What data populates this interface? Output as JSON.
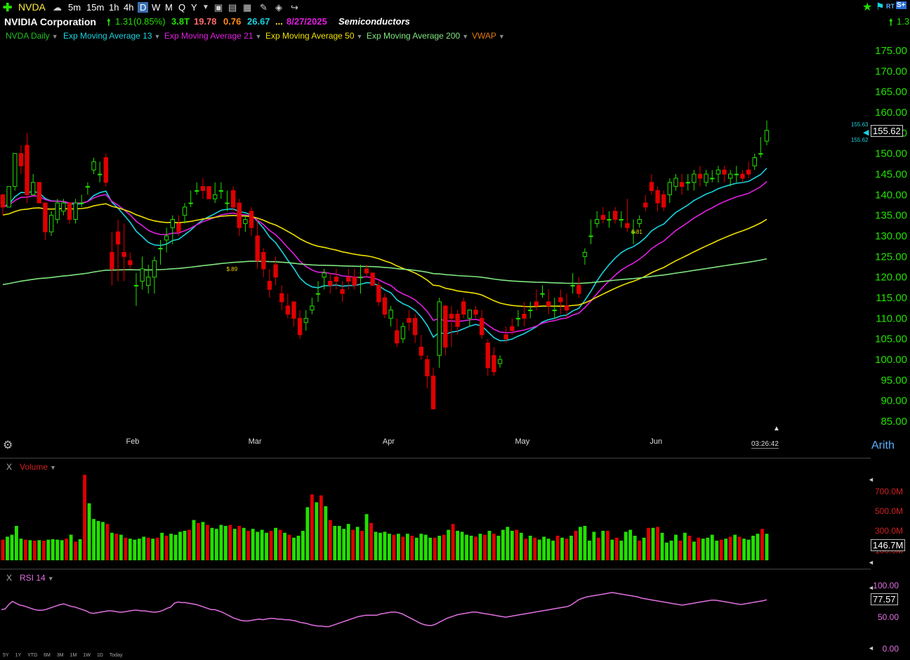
{
  "toolbar": {
    "symbol": "NVDA",
    "timeframes": [
      "5m",
      "15m",
      "1h",
      "4h",
      "D",
      "W",
      "M",
      "Q",
      "Y"
    ],
    "active_timeframe": "D",
    "rt_label": "RT",
    "right_change": "1.3"
  },
  "info": {
    "company": "NVIDIA Corporation",
    "change": "1.31",
    "change_pct": "(0.85%)",
    "market_cap": "3.8T",
    "v1": "19.78",
    "v2": "0.76",
    "v3": "26.67",
    "ellipsis": "...",
    "date": "8/27/2025",
    "sector": "Semiconductors"
  },
  "studies": [
    {
      "label": "NVDA Daily",
      "color": "#20c020"
    },
    {
      "label": "Exp Moving Average 13",
      "color": "#19d3e0"
    },
    {
      "label": "Exp Moving Average 21",
      "color": "#e020e0"
    },
    {
      "label": "Exp Moving Average 50",
      "color": "#f0e000"
    },
    {
      "label": "Exp Moving Average 200",
      "color": "#7fe57f"
    },
    {
      "label": "VWAP",
      "color": "#e07a10"
    }
  ],
  "colors": {
    "up": "#22e000",
    "down": "#e00000",
    "price_axis": "#22e000",
    "volume_label": "#d02020",
    "rsi": "#e070e0"
  },
  "chart_data": {
    "type": "candlestick",
    "y_axis_ticks": [
      "175.00",
      "170.00",
      "165.00",
      "160.00",
      "155.00",
      "150.00",
      "145.00",
      "140.00",
      "135.00",
      "130.00",
      "125.00",
      "120.00",
      "115.00",
      "110.00",
      "105.00",
      "100.00",
      "95.00",
      "90.00",
      "85.00"
    ],
    "ylim": [
      85,
      175
    ],
    "x_axis_labels": [
      "Feb",
      "Mar",
      "Apr",
      "May",
      "Jun"
    ],
    "last_price": "155.62",
    "bid_label": "155.63",
    "ask_label": "155.62",
    "time_readout": "03:26:42",
    "scale_mode": "Arith",
    "candles": [
      [
        140,
        140,
        135,
        137
      ],
      [
        137,
        142,
        137,
        142
      ],
      [
        142,
        150,
        141,
        150
      ],
      [
        150,
        152,
        145,
        147
      ],
      [
        152,
        155,
        138,
        140
      ],
      [
        140,
        145,
        140,
        143
      ],
      [
        143,
        143,
        138,
        138
      ],
      [
        138,
        138,
        129,
        131
      ],
      [
        131,
        136,
        130,
        135
      ],
      [
        134,
        139,
        133,
        138
      ],
      [
        136,
        139,
        135,
        138
      ],
      [
        138,
        138,
        133,
        134
      ],
      [
        134,
        139,
        133,
        138
      ],
      [
        138,
        140,
        137,
        138
      ],
      [
        142,
        143,
        140,
        142
      ],
      [
        146,
        149,
        145,
        148
      ],
      [
        145,
        148,
        143,
        145
      ],
      [
        149,
        150,
        142,
        143
      ],
      [
        126,
        131,
        118,
        122
      ],
      [
        131,
        134,
        119,
        128
      ],
      [
        126,
        133,
        119,
        125
      ],
      [
        124,
        126,
        122,
        123
      ],
      [
        118,
        121,
        113,
        118
      ],
      [
        119,
        125,
        117,
        122
      ],
      [
        118,
        123,
        116,
        120
      ],
      [
        120,
        125,
        116,
        124
      ],
      [
        127,
        129,
        123,
        127
      ],
      [
        129,
        132,
        126,
        130
      ],
      [
        132,
        135,
        128,
        134
      ],
      [
        133,
        135,
        130,
        131
      ],
      [
        135,
        138,
        133,
        137
      ],
      [
        138,
        141,
        137,
        138
      ],
      [
        141,
        143,
        140,
        141
      ],
      [
        142,
        144,
        139,
        141
      ],
      [
        142,
        142,
        139,
        139
      ],
      [
        139,
        143,
        138,
        140
      ],
      [
        141,
        143,
        139,
        141
      ],
      [
        138,
        141,
        136,
        138
      ],
      [
        141,
        142,
        136,
        137
      ],
      [
        138,
        139,
        130,
        132
      ],
      [
        133,
        135,
        131,
        134
      ],
      [
        136,
        137,
        130,
        132
      ],
      [
        130,
        134,
        122,
        124
      ],
      [
        126,
        127,
        120,
        122
      ],
      [
        119,
        122,
        115,
        117
      ],
      [
        123,
        125,
        118,
        120
      ],
      [
        116,
        118,
        112,
        114
      ],
      [
        113,
        116,
        110,
        111
      ],
      [
        114,
        114,
        108,
        110
      ],
      [
        110,
        112,
        105,
        106
      ],
      [
        109,
        112,
        107,
        110
      ],
      [
        112,
        115,
        111,
        113
      ],
      [
        116,
        119,
        114,
        116
      ],
      [
        120,
        122,
        117,
        121
      ],
      [
        119,
        121,
        116,
        118
      ],
      [
        120,
        122,
        117,
        119
      ],
      [
        117,
        119,
        114,
        116
      ],
      [
        120,
        122,
        117,
        119
      ],
      [
        120,
        122,
        117,
        118
      ],
      [
        120,
        123,
        116,
        120
      ],
      [
        122,
        123,
        120,
        121
      ],
      [
        121,
        121,
        118,
        118
      ],
      [
        118,
        119,
        113,
        114
      ],
      [
        115,
        116,
        110,
        111
      ],
      [
        110,
        113,
        108,
        112
      ],
      [
        107,
        110,
        103,
        104
      ],
      [
        105,
        109,
        104,
        108
      ],
      [
        110,
        112,
        107,
        109
      ],
      [
        110,
        111,
        104,
        106
      ],
      [
        103,
        106,
        100,
        101
      ],
      [
        100,
        101,
        93,
        96
      ],
      [
        96,
        98,
        88,
        88
      ],
      [
        101,
        115,
        98,
        114
      ],
      [
        113,
        113,
        101,
        103
      ],
      [
        111,
        113,
        103,
        110
      ],
      [
        111,
        112,
        106,
        108
      ],
      [
        114,
        115,
        110,
        111
      ],
      [
        110,
        112,
        108,
        112
      ],
      [
        112,
        113,
        110,
        111
      ],
      [
        110,
        112,
        105,
        106
      ],
      [
        104,
        105,
        96,
        98
      ],
      [
        101,
        103,
        96,
        97
      ],
      [
        99,
        101,
        98,
        100
      ],
      [
        106,
        108,
        104,
        105
      ],
      [
        108,
        110,
        106,
        107
      ],
      [
        110,
        112,
        108,
        110
      ],
      [
        111,
        114,
        108,
        110
      ],
      [
        112,
        114,
        110,
        112
      ],
      [
        114,
        117,
        112,
        113
      ],
      [
        116,
        118,
        115,
        116
      ],
      [
        114,
        117,
        111,
        113
      ],
      [
        112,
        115,
        110,
        112
      ],
      [
        115,
        117,
        111,
        114
      ],
      [
        113,
        116,
        110,
        112
      ],
      [
        118,
        121,
        116,
        118
      ],
      [
        118,
        120,
        115,
        116
      ],
      [
        125,
        127,
        123,
        126
      ],
      [
        130,
        134,
        128,
        130
      ],
      [
        133,
        136,
        132,
        134
      ],
      [
        135,
        137,
        133,
        134
      ],
      [
        134,
        136,
        132,
        134
      ],
      [
        136,
        137,
        133,
        134
      ],
      [
        134,
        136,
        132,
        134
      ],
      [
        133,
        139,
        131,
        132
      ],
      [
        131,
        134,
        128,
        131
      ],
      [
        133,
        135,
        132,
        134
      ],
      [
        138,
        140,
        136,
        137
      ],
      [
        143,
        145,
        140,
        141
      ],
      [
        141,
        142,
        136,
        138
      ],
      [
        140,
        141,
        136,
        137
      ],
      [
        140,
        144,
        138,
        143
      ],
      [
        142,
        145,
        141,
        144
      ],
      [
        143,
        145,
        140,
        142
      ],
      [
        143,
        145,
        141,
        143
      ],
      [
        143,
        146,
        141,
        145
      ],
      [
        145,
        147,
        142,
        144
      ],
      [
        143,
        146,
        142,
        145
      ],
      [
        144,
        146,
        143,
        144
      ],
      [
        145,
        147,
        143,
        146
      ],
      [
        146,
        147,
        143,
        145
      ],
      [
        144,
        146,
        142,
        145
      ],
      [
        145,
        147,
        143,
        145
      ],
      [
        145,
        146,
        143,
        144
      ],
      [
        146,
        148,
        144,
        145
      ],
      [
        147,
        150,
        146,
        149
      ],
      [
        150,
        154,
        149,
        150
      ],
      [
        153,
        158,
        152,
        155.62
      ]
    ],
    "series": [
      {
        "name": "Exp Moving Average 13",
        "color": "#19d3e0"
      },
      {
        "name": "Exp Moving Average 21",
        "color": "#e020e0"
      },
      {
        "name": "Exp Moving Average 50",
        "color": "#f0e000"
      },
      {
        "name": "Exp Moving Average 200",
        "color": "#7fe57f"
      }
    ],
    "annotations": [
      {
        "label": "$.89"
      },
      {
        "label": "$.81"
      }
    ],
    "volume": {
      "label": "Volume",
      "ticks": [
        "700.0M",
        "500.0M",
        "300.0M",
        "100.0M"
      ],
      "ylim": [
        0,
        900
      ],
      "last_value": "146.7M",
      "values": [
        210,
        240,
        260,
        350,
        220,
        210,
        205,
        200,
        205,
        200,
        210,
        215,
        210,
        205,
        220,
        260,
        190,
        215,
        870,
        580,
        420,
        400,
        390,
        370,
        280,
        270,
        260,
        230,
        220,
        210,
        220,
        240,
        230,
        220,
        230,
        280,
        250,
        270,
        260,
        290,
        300,
        310,
        410,
        380,
        390,
        360,
        330,
        320,
        360,
        350,
        360,
        320,
        350,
        330,
        300,
        320,
        290,
        310,
        280,
        300,
        330,
        310,
        280,
        260,
        230,
        250,
        300,
        540,
        670,
        590,
        660,
        550,
        410,
        350,
        350,
        320,
        370,
        310,
        340,
        300,
        470,
        380,
        290,
        280,
        290,
        270,
        260,
        270,
        240,
        270,
        250,
        230,
        270,
        260,
        230,
        230,
        250,
        260,
        310,
        370,
        300,
        290,
        260,
        250,
        240,
        270,
        260,
        300,
        270,
        250,
        310,
        340,
        300,
        310,
        280,
        220,
        250,
        230,
        210,
        240,
        220,
        200,
        250,
        230,
        220,
        250,
        300,
        340,
        350,
        200,
        290,
        230,
        300,
        300,
        210,
        230,
        200,
        290,
        310,
        250,
        200,
        230,
        330,
        330,
        340,
        280,
        180,
        200,
        260,
        200,
        280,
        250,
        190,
        230,
        220,
        230,
        260,
        200,
        210,
        220,
        240,
        260,
        240,
        220,
        210,
        250,
        270,
        320,
        270
      ]
    },
    "rsi": {
      "label": "RSI 14",
      "ticks": [
        "100.00",
        "50.00",
        "0.00"
      ],
      "ylim": [
        0,
        100
      ],
      "last_value": "77.57",
      "values": [
        62,
        63,
        70,
        75,
        72,
        69,
        68,
        66,
        64,
        62,
        61,
        61,
        62,
        64,
        66,
        68,
        70,
        71,
        69,
        67,
        66,
        64,
        62,
        60,
        57,
        56,
        57,
        58,
        59,
        60,
        60,
        59,
        58,
        58,
        59,
        60,
        61,
        61,
        60,
        60,
        59,
        58,
        58,
        59,
        61,
        64,
        66,
        72,
        74,
        73,
        73,
        72,
        71,
        70,
        68,
        66,
        64,
        62,
        62,
        60,
        58,
        55,
        52,
        49,
        47,
        45,
        44,
        44,
        45,
        46,
        47,
        46,
        47,
        48,
        48,
        47,
        47,
        46,
        46,
        45,
        44,
        42,
        41,
        40,
        38,
        37,
        36,
        36,
        35,
        35,
        37,
        39,
        41,
        43,
        45,
        47,
        49,
        51,
        52,
        53,
        53,
        53,
        53,
        55,
        56,
        57,
        58,
        58,
        57,
        55,
        52,
        49,
        46,
        43,
        40,
        38,
        37,
        37,
        39,
        42,
        45,
        48,
        50,
        52,
        54,
        55,
        56,
        57,
        58,
        58,
        57,
        56,
        55,
        54,
        53,
        52,
        51,
        50,
        51,
        52,
        53,
        54,
        55,
        56,
        57,
        58,
        59,
        60,
        61,
        62,
        63,
        64,
        65,
        66,
        67,
        70,
        74,
        78,
        80,
        82,
        83,
        84,
        85,
        86,
        87,
        88,
        89,
        88,
        87,
        86,
        85,
        84,
        83,
        82,
        80,
        79,
        78,
        77,
        76,
        75,
        74,
        73,
        72,
        71,
        70,
        69,
        70,
        71,
        72,
        73,
        74,
        75,
        76,
        77,
        77,
        76,
        75,
        74,
        73,
        72,
        71,
        70,
        71,
        72,
        73,
        74,
        75,
        76,
        77.57
      ]
    },
    "period_buttons": [
      "5Y",
      "1Y",
      "YTD",
      "6M",
      "3M",
      "1M",
      "1W",
      "1D",
      "Today"
    ]
  }
}
